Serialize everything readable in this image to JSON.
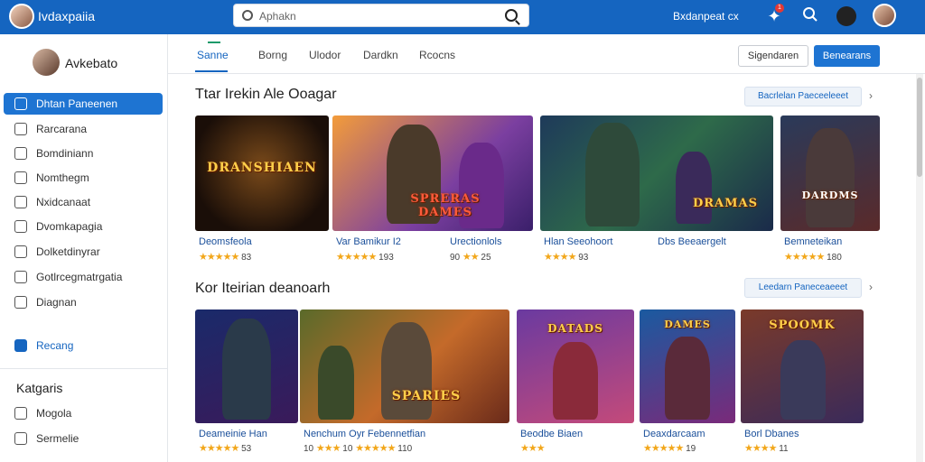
{
  "header": {
    "app_name": "Ivdaxpaiia",
    "search_placeholder": "Aphakn",
    "link_label": "Bxdanpeat cx",
    "notification_count": "1",
    "icons": [
      "brand-avatar",
      "search-icon",
      "puzzle-icon",
      "search-icon",
      "leaf-icon",
      "user-avatar"
    ]
  },
  "sidebar": {
    "profile_name": "Avkebato",
    "items": [
      {
        "label": "Dhtan Paneenen",
        "icon": "bookmark-icon",
        "active": true
      },
      {
        "label": "Rarcarana",
        "icon": "controller-icon"
      },
      {
        "label": "Bomdiniann",
        "icon": "book-icon"
      },
      {
        "label": "Nomthegm",
        "icon": "users-icon"
      },
      {
        "label": "Nxidcanaat",
        "icon": "gift-icon"
      },
      {
        "label": "Dvomkapagia",
        "icon": "tag-icon"
      },
      {
        "label": "Dolketdinyrar",
        "icon": "calendar-icon"
      },
      {
        "label": "Gotlrcegmatrgatia",
        "icon": "bag-icon"
      },
      {
        "label": "Diagnan",
        "icon": "gear-icon"
      },
      {
        "label": "Recang",
        "icon": "bookmark-filled-icon",
        "blue": true
      }
    ],
    "heading": "Katgaris",
    "category_items": [
      {
        "label": "Mogola",
        "icon": "user-icon"
      },
      {
        "label": "Sermelie",
        "icon": "chat-icon"
      }
    ]
  },
  "tabs": [
    {
      "label": "Sanne",
      "active": true
    },
    {
      "label": "Borng"
    },
    {
      "label": "Ulodor"
    },
    {
      "label": "Dardkn"
    },
    {
      "label": "Rcocns"
    }
  ],
  "actions": {
    "secondary_label": "Sigendaren",
    "primary_label": "Benearans"
  },
  "sections": [
    {
      "title": "Ttar Irekin Ale Ooagar",
      "pill_label": "Bacrlelan Paeceeleeet",
      "cards": [
        {
          "title": "Deomsfeola",
          "stars": "★★★★★",
          "rating": "83",
          "logo": "DRANSHIAEN"
        },
        {
          "title": "Var Bamikur I2",
          "stars": "★★★★★",
          "rating": "193",
          "logo": "SPRERAS DAMES"
        },
        {
          "title": "Urectionlols",
          "stars": "★★",
          "prefix": "90",
          "rating": "25",
          "logo": ""
        },
        {
          "title": "Hlan Seeohoort",
          "stars": "★★★★",
          "rating": "93",
          "logo": "DRAMAS"
        },
        {
          "title": "Dbs Beeaergelt",
          "stars": "",
          "rating": "",
          "logo": "DRAMAS"
        },
        {
          "title": "Bemneteikan",
          "stars": "★★★★★",
          "rating": "180",
          "logo": "DARDMS"
        }
      ]
    },
    {
      "title": "Kor Iteirian deanoarh",
      "pill_label": "Leedarn Paneceaeeet",
      "cards": [
        {
          "title": "Deameinie Han",
          "stars": "★★★★★",
          "rating": "53",
          "logo": ""
        },
        {
          "title": "Nenchum Oyr Febennetfian",
          "stars": "★★★",
          "prefix": "10",
          "rating": "10",
          "logo": "SPARIES"
        },
        {
          "title": "",
          "stars": "★★★★★",
          "rating": "110",
          "logo": ""
        },
        {
          "title": "Beodbe Biaen",
          "stars": "★★★",
          "rating": "",
          "logo": "DATADS"
        },
        {
          "title": "Deaxdarcaam",
          "stars": "★★★★★",
          "rating": "19",
          "logo": "DAMES"
        },
        {
          "title": "Borl Dbanes",
          "stars": "★★★★",
          "rating": "11",
          "logo": "SPOOMK"
        }
      ]
    }
  ],
  "colors": {
    "topbar": "#1565c0",
    "accent": "#1e74d2",
    "star": "#f2a71b"
  }
}
